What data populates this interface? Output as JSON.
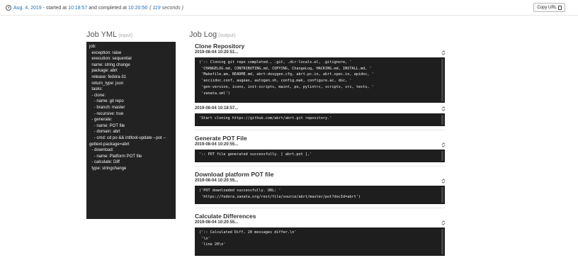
{
  "header": {
    "date": "Aug. 4, 2019",
    "started_label": " - started at ",
    "start_time": "10:18:57",
    "completed_label": " and completed at ",
    "end_time": "10:20:56",
    "duration_num": "119",
    "duration_unit": "seconds",
    "copy_label": "Copy URL"
  },
  "yml": {
    "title": "Job YML",
    "subtitle": "(input)",
    "content": "job:\n  exception: raise\n  execution: sequential\n  name: string change\n  package: abrt\n  release: fedora-31\n  return_type: json\n  tasks:\n  - clone:\n    - name: git repo\n    - branch: master\n    - recursive: true\n  - generate:\n    - name: POT file\n    - domain: abrt\n    - cmd: cd po && intltool-update --pot --gettext-package=abrt\n  - download:\n    - name: Platform POT file\n  - calculate: Diff\n  type: stringchange"
  },
  "log": {
    "title": "Job Log",
    "subtitle": "(output)",
    "entries": [
      {
        "title": "Clone Repository",
        "blocks": [
          {
            "ts": "2019-08-04 10:20:51...",
            "code": "(':: Cloning git repo completed., .git, .dir-locals.el, .gitignore, '\n 'CHANGELOG.md, CONTRIBUTING.md, COPYING, ChangeLog, HACKING.md, INSTALL.md, '\n 'Makefile.am, README.md, abrt-doxygen.cfg, abrt.pc.in, abrt.spec.in, apidoc, '\n 'asciidoc.conf, augeas, autogen.sh, config.mak, configure.ac, doc, '\n 'gen-version, icons, init-scripts, maint, po, pylintrc, scripts, src, tests, '\n 'zanata.xml')"
          },
          {
            "ts": "2019-08-04 10:18:57...",
            "code": "'Start cloning https://github.com/abrt/abrt.git repository.'"
          }
        ]
      },
      {
        "title": "Generate POT File",
        "blocks": [
          {
            "ts": "2019-08-04 10:20:55...",
            "code": "':: POT file generated successfully. [ abrt.pot ],'"
          }
        ]
      },
      {
        "title": "Download platform POT file",
        "blocks": [
          {
            "ts": "2019-08-04 10:20:55...",
            "code": "('POT downloaded successfully. URL: '\n 'https://fedora.zanata.org/rest/file/source/abrt/master/pot?docId=abrt')"
          }
        ]
      },
      {
        "title": "Calculate Differences",
        "blocks": [
          {
            "ts": "2019-08-04 10:20:55...",
            "code": "(':: Calculated Diff, 20 messages differ.\\n'\n '\\n'\n 'line 20\\n'"
          }
        ]
      }
    ]
  }
}
